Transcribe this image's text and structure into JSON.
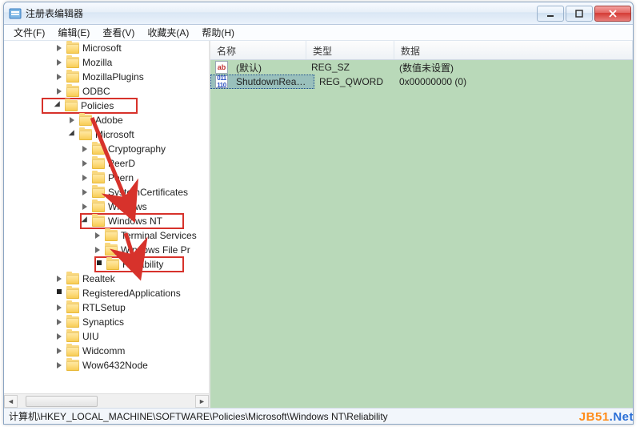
{
  "window": {
    "title": "注册表编辑器"
  },
  "menus": {
    "file": "文件(F)",
    "edit": "编辑(E)",
    "view": "查看(V)",
    "favorites": "收藏夹(A)",
    "help": "帮助(H)"
  },
  "tree_nodes": {
    "microsoft": "Microsoft",
    "mozilla": "Mozilla",
    "mozillaplugins": "MozillaPlugins",
    "odbc": "ODBC",
    "policies": "Policies",
    "adobe": "Adobe",
    "microsoft2": "Microsoft",
    "cryptography": "Cryptography",
    "peerd": "PeerD",
    "peern": "Peern",
    "systemcertificates": "SystemCertificates",
    "windows": "Windows",
    "windows_nt": "Windows NT",
    "terminal_services": "Terminal Services",
    "windows_file_p": "Windows File Pr",
    "reliability": "Reliability",
    "realtek": "Realtek",
    "registeredapplications": "RegisteredApplications",
    "rtlsetup": "RTLSetup",
    "synaptics": "Synaptics",
    "uiu": "UIU",
    "widcomm": "Widcomm",
    "wow6432node": "Wow6432Node"
  },
  "list_headers": {
    "name": "名称",
    "type": "类型",
    "data": "数据"
  },
  "list_rows": [
    {
      "icon": "str",
      "name": "(默认)",
      "type": "REG_SZ",
      "data": "(数值未设置)"
    },
    {
      "icon": "bin",
      "name": "ShutdownReas...",
      "type": "REG_QWORD",
      "data": "0x00000000 (0)"
    }
  ],
  "statusbar": {
    "path": "计算机\\HKEY_LOCAL_MACHINE\\SOFTWARE\\Policies\\Microsoft\\Windows NT\\Reliability"
  },
  "watermark": {
    "part1": "JB51",
    "part2": ".Net"
  },
  "col_widths": {
    "name": 120,
    "type": 110,
    "data": 260
  }
}
